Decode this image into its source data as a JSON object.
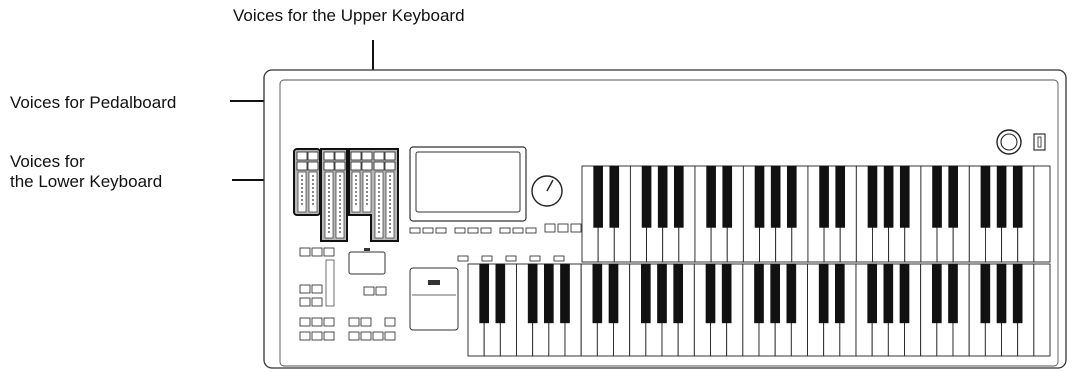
{
  "labels": {
    "upper": "Voices for the Upper Keyboard",
    "pedal": "Voices for Pedalboard",
    "lower_line1": "Voices for",
    "lower_line2": "the Lower Keyboard"
  },
  "upper_manual": {
    "octaves": 4,
    "extra_key": true
  },
  "lower_manual": {
    "octaves": 5,
    "extra_key": true
  }
}
